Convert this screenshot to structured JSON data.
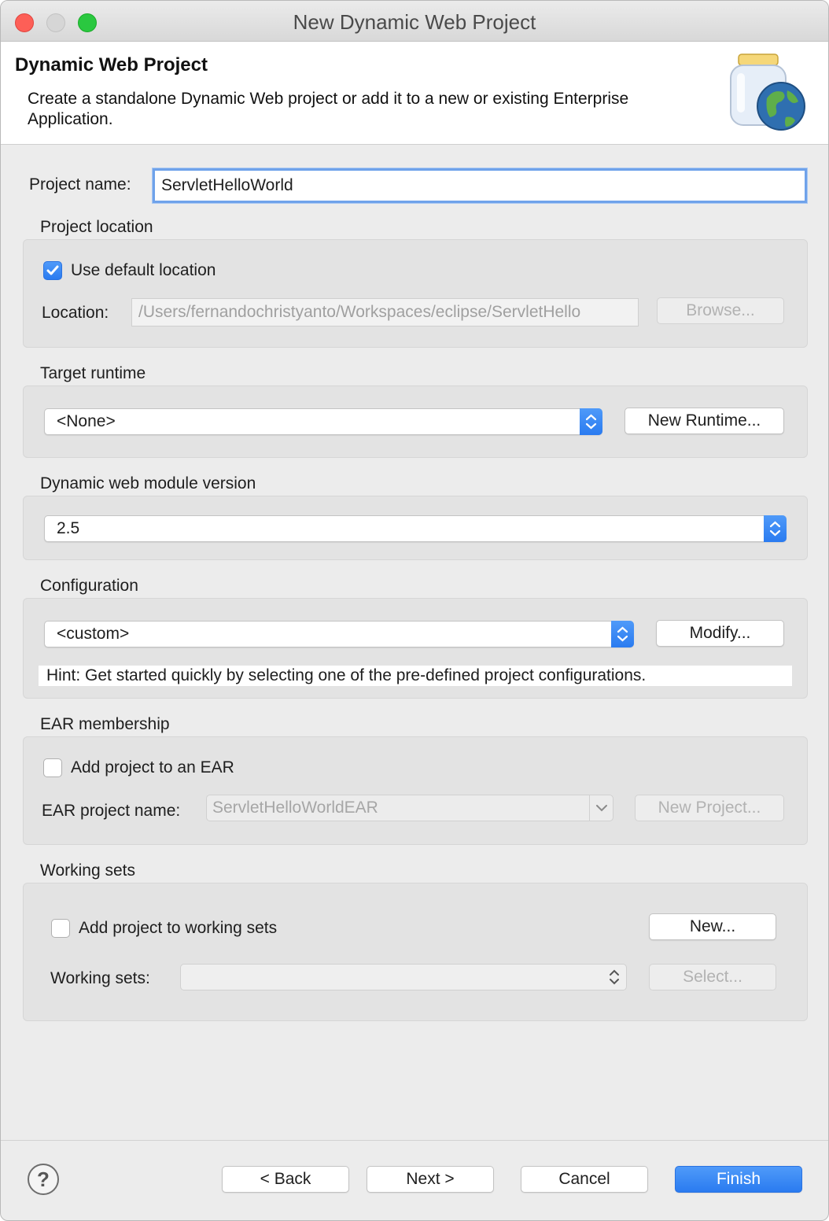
{
  "window": {
    "title": "New Dynamic Web Project"
  },
  "banner": {
    "title": "Dynamic Web Project",
    "description": "Create a standalone Dynamic Web project or add it to a new or existing Enterprise Application."
  },
  "project_name": {
    "label": "Project name:",
    "value": "ServletHelloWorld"
  },
  "project_location": {
    "heading": "Project location",
    "use_default_label": "Use default location",
    "use_default_checked": true,
    "location_label": "Location:",
    "location_value": "/Users/fernandochristyanto/Workspaces/eclipse/ServletHello",
    "browse_label": "Browse..."
  },
  "target_runtime": {
    "heading": "Target runtime",
    "selected": "<None>",
    "new_runtime_label": "New Runtime..."
  },
  "module_version": {
    "heading": "Dynamic web module version",
    "selected": "2.5"
  },
  "configuration": {
    "heading": "Configuration",
    "selected": "<custom>",
    "modify_label": "Modify...",
    "hint": "Hint: Get started quickly by selecting one of the pre-defined project configurations."
  },
  "ear_membership": {
    "heading": "EAR membership",
    "add_to_ear_label": "Add project to an EAR",
    "add_to_ear_checked": false,
    "ear_name_label": "EAR project name:",
    "ear_name_value": "ServletHelloWorldEAR",
    "new_project_label": "New Project..."
  },
  "working_sets": {
    "heading": "Working sets",
    "add_label": "Add project to working sets",
    "add_checked": false,
    "new_label": "New...",
    "sets_label": "Working sets:",
    "sets_value": "",
    "select_label": "Select..."
  },
  "footer": {
    "help_label": "?",
    "back_label": "< Back",
    "next_label": "Next >",
    "cancel_label": "Cancel",
    "finish_label": "Finish"
  },
  "colors": {
    "accent": "#2a7bf0",
    "focus_ring": "#6fa2ea",
    "panel": "#e3e3e3",
    "window_bg": "#ececec"
  },
  "icons": {
    "banner": "web-project-jar-globe-icon",
    "checkmark": "checkmark-icon",
    "stepper": "up-down-arrows-icon",
    "dropdown": "chevron-down-icon"
  }
}
